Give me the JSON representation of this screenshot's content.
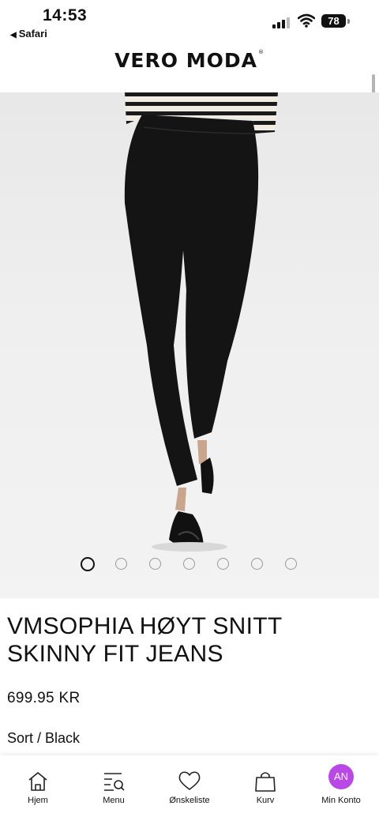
{
  "status_bar": {
    "time": "14:53",
    "back_label": "Safari",
    "battery": "78"
  },
  "header": {
    "brand": "VERO MODA",
    "registered": "®"
  },
  "product": {
    "image_count": 7,
    "active_image": 1,
    "title": "VMSOPHIA HØYT SNITT SKINNY FIT JEANS",
    "price": "699.95 KR",
    "color": "Sort / Black"
  },
  "tabbar": {
    "items": [
      {
        "label": "Hjem",
        "icon": "home-icon"
      },
      {
        "label": "Menu",
        "icon": "menu-search-icon"
      },
      {
        "label": "Ønskeliste",
        "icon": "heart-icon"
      },
      {
        "label": "Kurv",
        "icon": "bag-icon"
      },
      {
        "label": "Min Konto",
        "icon": "avatar",
        "avatar_initials": "AN"
      }
    ]
  },
  "colors": {
    "avatar": "#b948e6",
    "jeans": "#141414"
  }
}
